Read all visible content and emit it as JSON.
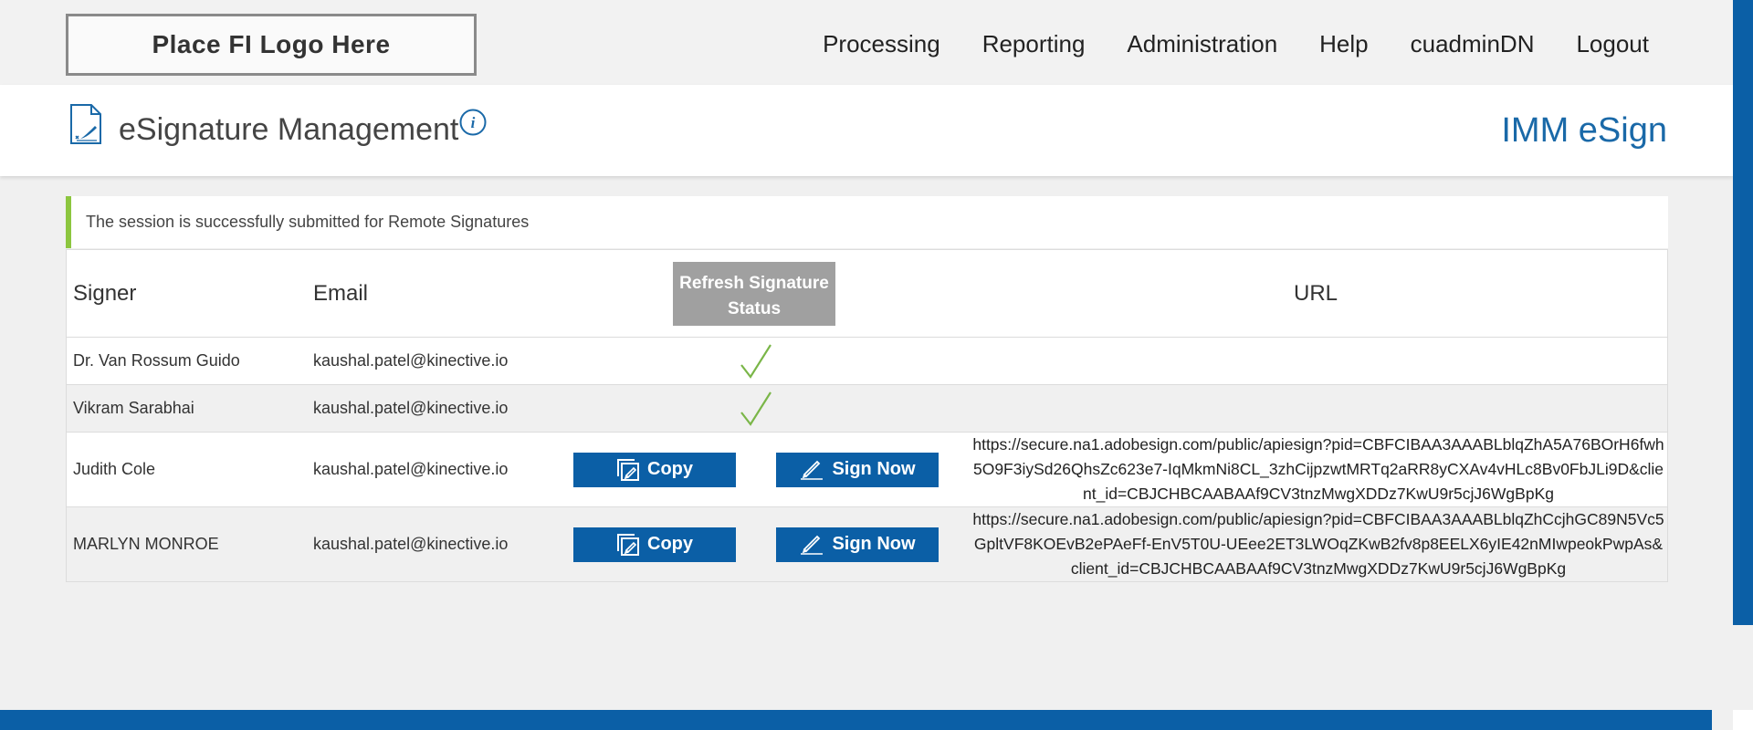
{
  "topbar": {
    "logo_text": "Place FI Logo Here",
    "nav": [
      "Processing",
      "Reporting",
      "Administration",
      "Help",
      "cuadminDN",
      "Logout"
    ]
  },
  "header": {
    "title": "eSignature Management",
    "brand": "IMM eSign",
    "icons": [
      "document-signature-icon",
      "info-icon"
    ]
  },
  "alert": {
    "message": "The session is successfully submitted for Remote Signatures",
    "accent_color": "#8cc63f"
  },
  "table": {
    "headers": {
      "signer": "Signer",
      "email": "Email",
      "refresh_button": "Refresh Signature Status",
      "url": "URL"
    },
    "copy_label": "Copy",
    "sign_label": "Sign Now",
    "rows": [
      {
        "signer": "Dr. Van Rossum Guido",
        "email": "kaushal.patel@kinective.io",
        "status": "signed"
      },
      {
        "signer": "Vikram Sarabhai",
        "email": "kaushal.patel@kinective.io",
        "status": "signed"
      },
      {
        "signer": "Judith Cole",
        "email": "kaushal.patel@kinective.io",
        "status": "pending",
        "url": "https://secure.na1.adobesign.com/public/apiesign?pid=CBFCIBAA3AAABLblqZhA5A76BOrH6fwh5O9F3iySd26QhsZc623e7-IqMkmNi8CL_3zhCijpzwtMRTq2aRR8yCXAv4vHLc8Bv0FbJLi9D&client_id=CBJCHBCAABAAf9CV3tnzMwgXDDz7KwU9r5cjJ6WgBpKg"
      },
      {
        "signer": "MARLYN MONROE",
        "email": "kaushal.patel@kinective.io",
        "status": "pending",
        "url": "https://secure.na1.adobesign.com/public/apiesign?pid=CBFCIBAA3AAABLblqZhCcjhGC89N5Vc5GpltVF8KOEvB2ePAeFf-EnV5T0U-UEee2ET3LWOqZKwB2fv8p8EELX6yIE42nMIwpeokPwpAs&client_id=CBJCHBCAABAAf9CV3tnzMwgXDDz7KwU9r5cjJ6WgBpKg"
      }
    ]
  },
  "colors": {
    "primary": "#0b5fa6",
    "brand_text": "#1a69a8",
    "refresh_button": "#a0a0a0",
    "check": "#7ab648"
  }
}
